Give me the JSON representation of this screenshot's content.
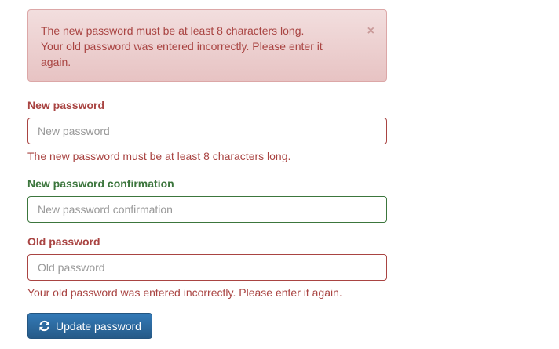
{
  "alert": {
    "messages": [
      "The new password must be at least 8 characters long.",
      "Your old password was entered incorrectly. Please enter it again."
    ],
    "close_label": "×"
  },
  "new_password": {
    "label": "New password",
    "placeholder": "New password",
    "value": "",
    "error": "The new password must be at least 8 characters long."
  },
  "confirmation": {
    "label": "New password confirmation",
    "placeholder": "New password confirmation",
    "value": ""
  },
  "old_password": {
    "label": "Old password",
    "placeholder": "Old password",
    "value": "",
    "error": "Your old password was entered incorrectly. Please enter it again."
  },
  "submit": {
    "label": "Update password",
    "icon": "refresh-icon"
  },
  "colors": {
    "error": "#a94442",
    "success": "#3c763d",
    "primary": "#337ab7",
    "alert_bg": "#f2dede"
  }
}
